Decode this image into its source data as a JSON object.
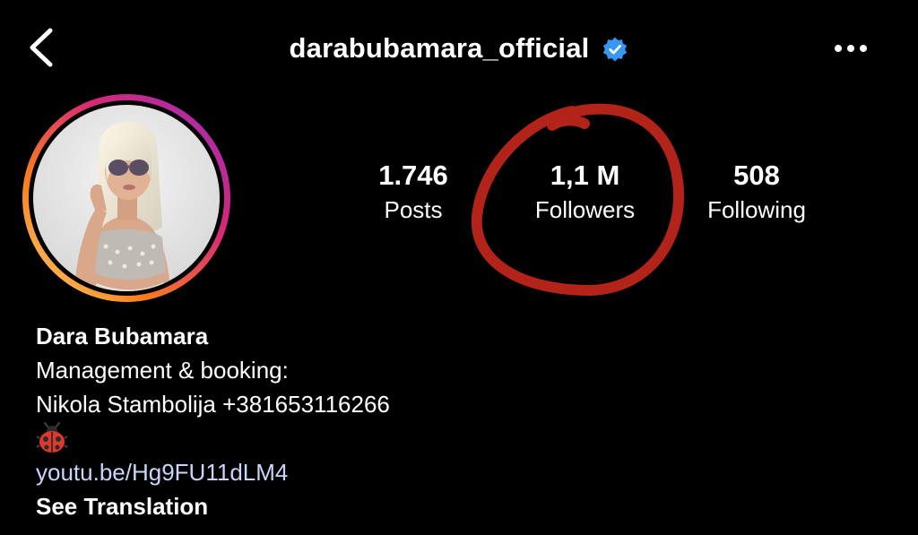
{
  "header": {
    "username": "darabubamara_official",
    "verified_icon": "verified-badge-icon",
    "back_icon": "chevron-left-icon",
    "more_icon": "more-horizontal-icon"
  },
  "stats": {
    "posts_count": "1.746",
    "posts_label": "Posts",
    "followers_count": "1,1 M",
    "followers_label": "Followers",
    "following_count": "508",
    "following_label": "Following"
  },
  "bio": {
    "name": "Dara Bubamara",
    "line1": "Management & booking:",
    "line2": "Nikola Stambolija +381653116266",
    "emoji_icon": "ladybug-icon",
    "link": "youtu.be/Hg9FU11dLM4",
    "see_translation": "See Translation"
  },
  "colors": {
    "background": "#000000",
    "text": "#ffffff",
    "verified_blue": "#3897f0",
    "link": "#c9d6f8",
    "story_ring": [
      "#feda75",
      "#fa7e1e",
      "#d62976",
      "#962fbf"
    ],
    "annotation_red": "#c0271b"
  }
}
